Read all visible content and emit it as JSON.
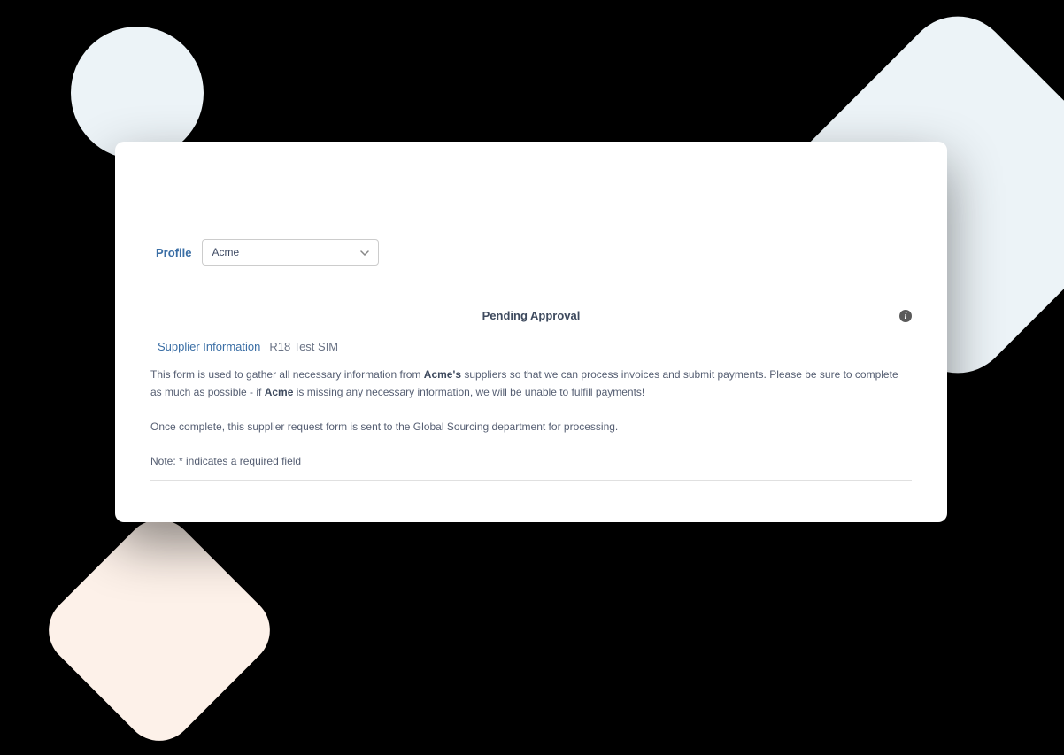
{
  "profile": {
    "label": "Profile",
    "selected": "Acme"
  },
  "status": {
    "text": "Pending Approval"
  },
  "supplier": {
    "link_label": "Supplier Information",
    "name": "R18 Test SIM"
  },
  "description": {
    "line1_prefix": "This form is used to gather all necessary information from ",
    "line1_bold": "Acme's",
    "line1_suffix": " suppliers so that we can process invoices and submit payments. Please be sure to complete as much as possible - if ",
    "line1_bold2": "Acme",
    "line1_end": " is missing any necessary information, we will be unable to fulfill payments!",
    "line2": "Once complete, this supplier request form is sent to the Global Sourcing department for processing."
  },
  "note": {
    "text": "Note: * indicates a required field"
  }
}
